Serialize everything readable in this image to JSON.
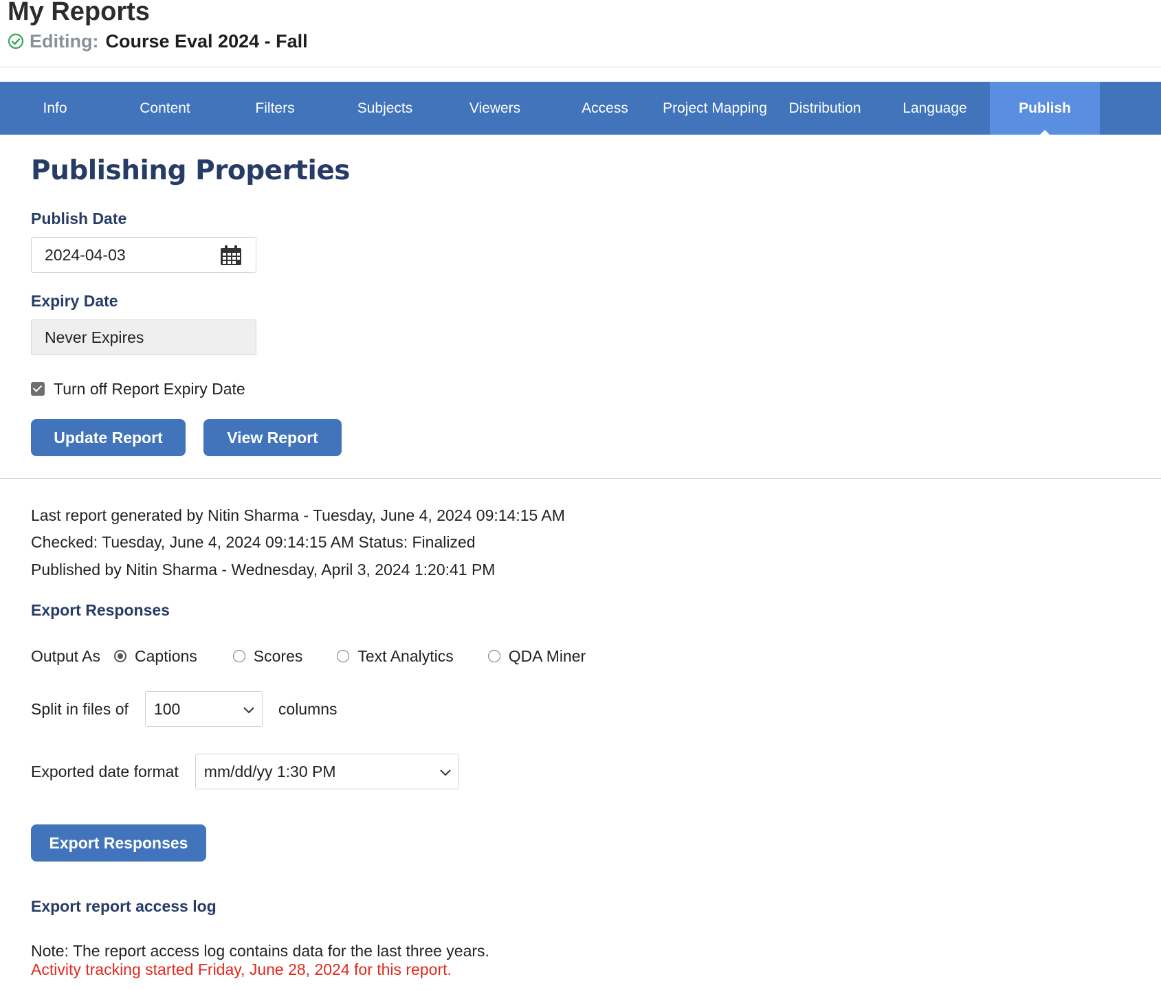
{
  "header": {
    "title": "My Reports",
    "editing_label": "Editing:",
    "report_name": "Course Eval 2024 - Fall"
  },
  "tabs": [
    {
      "label": "Info"
    },
    {
      "label": "Content"
    },
    {
      "label": "Filters"
    },
    {
      "label": "Subjects"
    },
    {
      "label": "Viewers"
    },
    {
      "label": "Access"
    },
    {
      "label": "Project Mapping"
    },
    {
      "label": "Distribution"
    },
    {
      "label": "Language"
    },
    {
      "label": "Publish"
    }
  ],
  "active_tab": "Publish",
  "publishing": {
    "heading": "Publishing Properties",
    "publish_date_label": "Publish Date",
    "publish_date_value": "2024-04-03",
    "expiry_date_label": "Expiry Date",
    "expiry_date_value": "Never Expires",
    "turn_off_expiry_label": "Turn off Report Expiry Date",
    "turn_off_expiry_checked": true,
    "update_button": "Update Report",
    "view_button": "View Report"
  },
  "status": {
    "last_generated": "Last report generated by Nitin Sharma - Tuesday, June 4, 2024 09:14:15 AM",
    "checked": "Checked: Tuesday, June 4, 2024 09:14:15 AM Status: Finalized",
    "published": "Published by Nitin Sharma - Wednesday, April 3, 2024 1:20:41 PM"
  },
  "export": {
    "heading": "Export Responses",
    "output_as_label": "Output As",
    "options": [
      "Captions",
      "Scores",
      "Text Analytics",
      "QDA Miner"
    ],
    "selected_option": "Captions",
    "split_label": "Split in files of",
    "split_value": "100",
    "split_suffix": "columns",
    "date_format_label": "Exported date format",
    "date_format_value": "mm/dd/yy 1:30 PM",
    "export_button": "Export Responses"
  },
  "access_log": {
    "heading": "Export report access log",
    "note": "Note: The report access log contains data for the last three years.",
    "tracking_note": "Activity tracking started Friday, June 28, 2024 for this report."
  },
  "colors": {
    "nav_bar": "#4174bb",
    "active_tab": "#5a8ee0",
    "heading": "#263c66",
    "button": "#4174bb",
    "warning_text": "#e12a1d",
    "check_icon": "#3aa35a"
  }
}
